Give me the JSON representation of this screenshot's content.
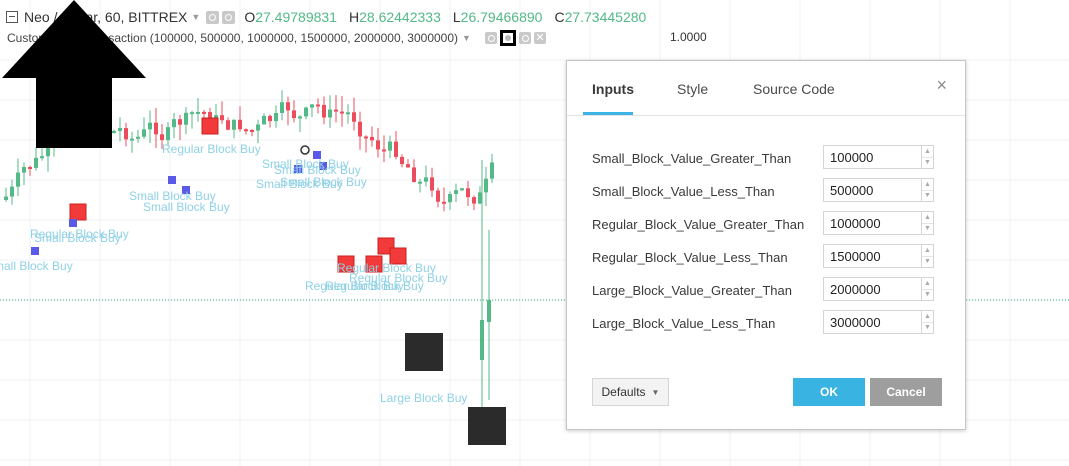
{
  "legend": {
    "symbol": "Neo / Dollar, 60, BITTREX",
    "open_label": "O",
    "open": "27.49789831",
    "high_label": "H",
    "high": "28.62442333",
    "low_label": "L",
    "low": "26.79466890",
    "close_label": "C",
    "close": "27.73445280"
  },
  "indicator": {
    "name": "Custom Block Transaction (100000, 500000, 1000000, 1500000, 2000000, 3000000)",
    "value": "1.0000"
  },
  "chart_labels": {
    "regular_buy": "Regular Block Buy",
    "small_buy": "Small Block Buy",
    "large_buy": "Large Block Buy"
  },
  "colors": {
    "up": "#53b987",
    "down": "#eb4d5c",
    "accent": "#39b3e1"
  },
  "dialog": {
    "tabs": [
      "Inputs",
      "Style",
      "Source Code"
    ],
    "close": "×",
    "inputs": [
      {
        "label": "Small_Block_Value_Greater_Than",
        "value": "100000"
      },
      {
        "label": "Small_Block_Value_Less_Than",
        "value": "500000"
      },
      {
        "label": "Regular_Block_Value_Greater_Than",
        "value": "1000000"
      },
      {
        "label": "Regular_Block_Value_Less_Than",
        "value": "1500000"
      },
      {
        "label": "Large_Block_Value_Greater_Than",
        "value": "2000000"
      },
      {
        "label": "Large_Block_Value_Less_Than",
        "value": "3000000"
      }
    ],
    "defaults_label": "Defaults",
    "ok_label": "OK",
    "cancel_label": "Cancel"
  }
}
